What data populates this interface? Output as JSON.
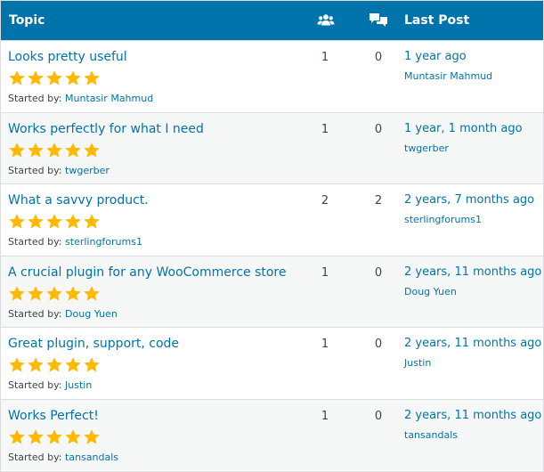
{
  "header": {
    "topic": "Topic",
    "last_post": "Last Post",
    "voices_icon": "users-icon",
    "replies_icon": "speech-bubbles-icon"
  },
  "colors": {
    "header_bg": "#0073aa",
    "link": "#0073aa",
    "star": "#ffb900",
    "row_alt": "#f6f7f7"
  },
  "started_by_label": "Started by:",
  "rows": [
    {
      "title": "Looks pretty useful",
      "rating": 5,
      "author": "Muntasir Mahmud",
      "voices": "1",
      "replies": "0",
      "freshness": "1 year ago",
      "last_author": "Muntasir Mahmud"
    },
    {
      "title": "Works perfectly for what I need",
      "rating": 5,
      "author": "twgerber",
      "voices": "1",
      "replies": "0",
      "freshness": "1 year, 1 month ago",
      "last_author": "twgerber"
    },
    {
      "title": "What a savvy product.",
      "rating": 5,
      "author": "sterlingforums1",
      "voices": "2",
      "replies": "2",
      "freshness": "2 years, 7 months ago",
      "last_author": "sterlingforums1"
    },
    {
      "title": "A crucial plugin for any WooCommerce store",
      "rating": 5,
      "author": "Doug Yuen",
      "voices": "1",
      "replies": "0",
      "freshness": "2 years, 11 months ago",
      "last_author": "Doug Yuen"
    },
    {
      "title": "Great plugin, support, code",
      "rating": 5,
      "author": "Justin",
      "voices": "1",
      "replies": "0",
      "freshness": "2 years, 11 months ago",
      "last_author": "Justin"
    },
    {
      "title": "Works Perfect!",
      "rating": 5,
      "author": "tansandals",
      "voices": "1",
      "replies": "0",
      "freshness": "2 years, 11 months ago",
      "last_author": "tansandals"
    }
  ]
}
